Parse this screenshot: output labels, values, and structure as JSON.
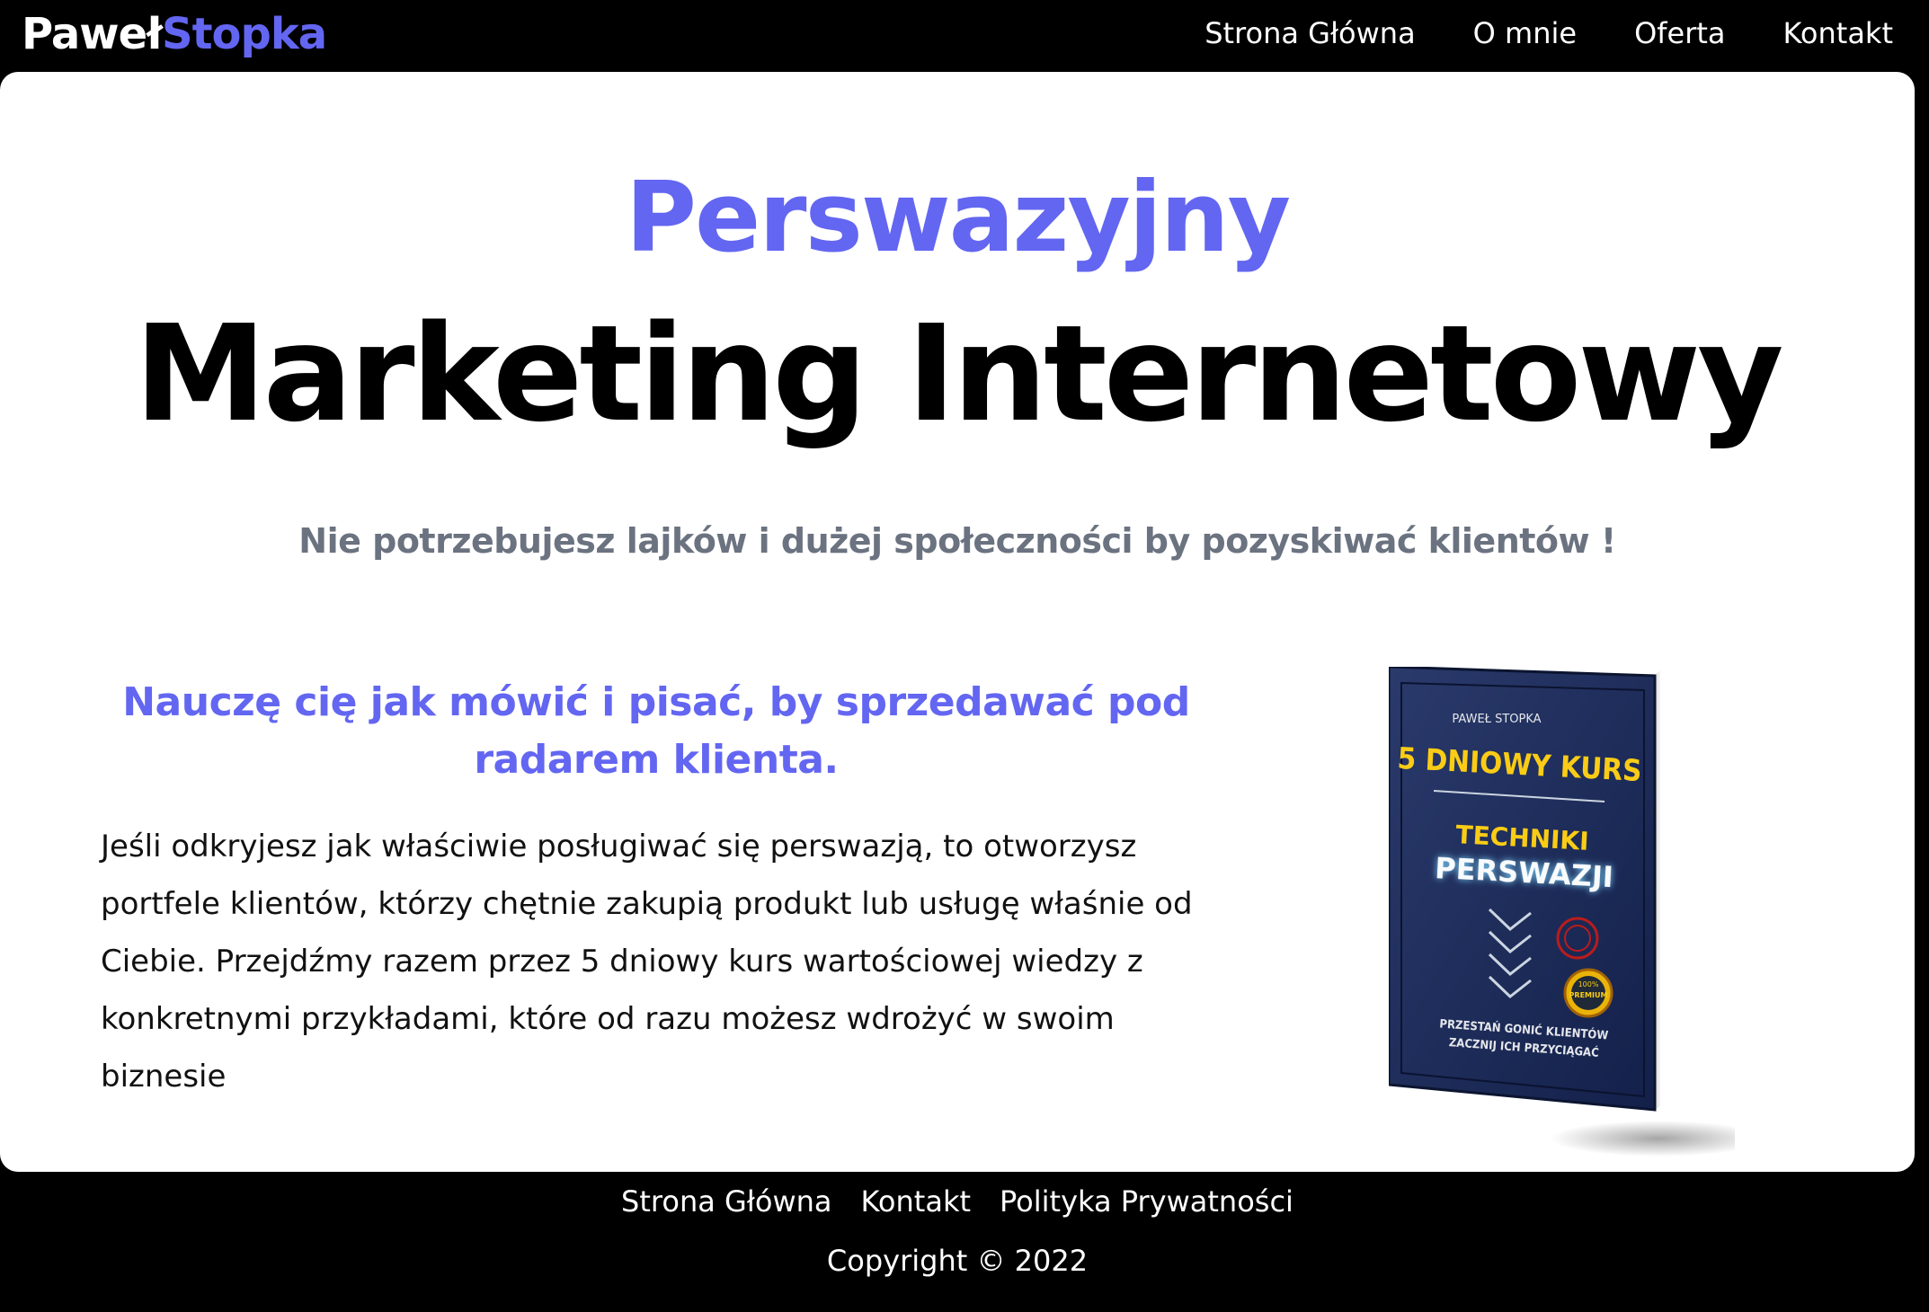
{
  "header": {
    "logo_first": "Paweł",
    "logo_second": "Stopka",
    "nav": [
      {
        "label": "Strona Główna"
      },
      {
        "label": "O mnie"
      },
      {
        "label": "Oferta"
      },
      {
        "label": "Kontakt"
      }
    ]
  },
  "hero": {
    "accent": "Perswazyjny",
    "title": "Marketing Internetowy",
    "subtitle": "Nie potrzebujesz lajków i dużej społeczności by pozyskiwać klientów !"
  },
  "section": {
    "heading": "Nauczę cię jak mówić i pisać, by sprzedawać pod radarem klienta.",
    "body": "Jeśli odkryjesz jak właściwie posługiwać się perswazją, to otworzysz portfele klientów, którzy chętnie zakupią produkt lub usługę właśnie od Ciebie. Przejdźmy razem przez 5 dniowy kurs wartościowej wiedzy z konkretnymi przykładami, które od razu możesz wdrożyć w swoim biznesie"
  },
  "book": {
    "author": "PAWEŁ STOPKA",
    "line1": "5 DNIOWY KURS",
    "line2": "TECHNIKI",
    "line3": "PERSWAZJI",
    "badge_top": "100%",
    "badge_mid": "PREMIUM",
    "tagline1": "PRZESTAŃ GONIĆ KLIENTÓW",
    "tagline2": "ZACZNIJ ICH PRZYCIĄGAĆ"
  },
  "footer": {
    "links": [
      {
        "label": "Strona Główna"
      },
      {
        "label": "Kontakt"
      },
      {
        "label": "Polityka Prywatności"
      }
    ],
    "copyright": "Copyright © 2022"
  },
  "colors": {
    "accent": "#6366f1",
    "background": "#000000",
    "card": "#ffffff",
    "subtitle": "#6b7280"
  }
}
